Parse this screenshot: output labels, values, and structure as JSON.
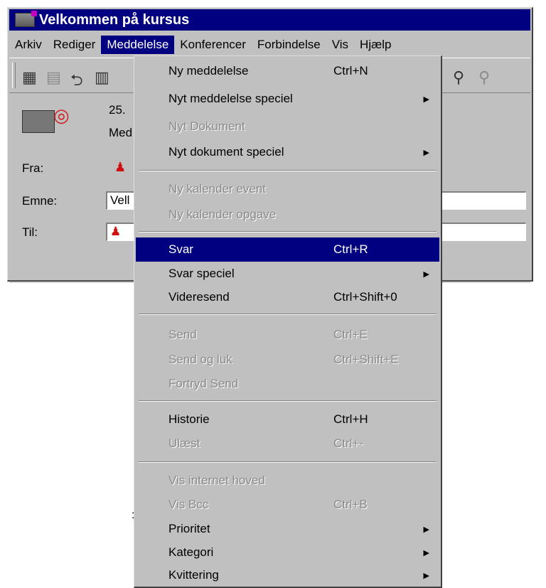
{
  "window": {
    "title": "Velkommen på kursus"
  },
  "menubar": [
    "Arkiv",
    "Rediger",
    "Meddelelse",
    "Konferencer",
    "Forbindelse",
    "Vis",
    "Hjælp"
  ],
  "header": {
    "date_fragment": "25.",
    "med_fragment": "Med",
    "from_label": "Fra:",
    "subject_label": "Emne:",
    "subject_value": "Vell",
    "to_label": "Til:"
  },
  "stray_char": ":",
  "menu": {
    "items": [
      {
        "label": "Ny meddelelse",
        "shortcut": "Ctrl+N",
        "disabled": false,
        "submenu": false
      },
      {
        "label": "Nyt meddelelse speciel",
        "shortcut": "",
        "disabled": false,
        "submenu": true
      },
      {
        "label": "Nyt Dokument",
        "shortcut": "",
        "disabled": true,
        "submenu": false
      },
      {
        "label": "Nyt dokument speciel",
        "shortcut": "",
        "disabled": false,
        "submenu": true
      },
      {
        "label": "Ny kalender event",
        "shortcut": "",
        "disabled": true,
        "submenu": false
      },
      {
        "label": "Ny kalender opgave",
        "shortcut": "",
        "disabled": true,
        "submenu": false
      },
      {
        "label": "Svar",
        "shortcut": "Ctrl+R",
        "disabled": false,
        "submenu": false,
        "selected": true
      },
      {
        "label": "Svar speciel",
        "shortcut": "",
        "disabled": false,
        "submenu": true
      },
      {
        "label": "Videresend",
        "shortcut": "Ctrl+Shift+0",
        "disabled": false,
        "submenu": false
      },
      {
        "label": "Send",
        "shortcut": "Ctrl+E",
        "disabled": true,
        "submenu": false
      },
      {
        "label": "Send og luk",
        "shortcut": "Ctrl+Shift+E",
        "disabled": true,
        "submenu": false
      },
      {
        "label": "Fortryd Send",
        "shortcut": "",
        "disabled": true,
        "submenu": false
      },
      {
        "label": "Historie",
        "shortcut": "Ctrl+H",
        "disabled": false,
        "submenu": false
      },
      {
        "label": "Ulæst",
        "shortcut": "Ctrl+-",
        "disabled": true,
        "submenu": false
      },
      {
        "label": "Vis internet hoved",
        "shortcut": "",
        "disabled": true,
        "submenu": false
      },
      {
        "label": "Vis Bcc",
        "shortcut": "Ctrl+B",
        "disabled": true,
        "submenu": false
      },
      {
        "label": "Prioritet",
        "shortcut": "",
        "disabled": false,
        "submenu": true
      },
      {
        "label": "Kategori",
        "shortcut": "",
        "disabled": false,
        "submenu": true
      },
      {
        "label": "Kvittering",
        "shortcut": "",
        "disabled": false,
        "submenu": true
      }
    ]
  },
  "icons": {
    "submenu": "▶",
    "search": "search-icon",
    "search_disabled": "search-disabled-icon",
    "envelope": "envelope-icon",
    "person": "person-icon"
  },
  "colors": {
    "titlebar": "#000080",
    "selection": "#000080",
    "chrome": "#c0c0c0",
    "disabled": "#8a8a8a"
  }
}
